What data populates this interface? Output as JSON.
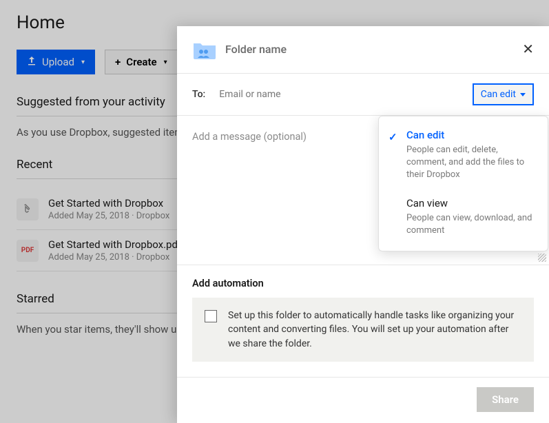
{
  "page": {
    "title": "Home",
    "upload_label": "Upload",
    "create_label": "Create",
    "suggested_heading": "Suggested from your activity",
    "suggested_text": "As you use Dropbox, suggested items will appear here.",
    "recent_heading": "Recent",
    "starred_heading": "Starred",
    "starred_text": "When you star items, they'll show up here.",
    "files": [
      {
        "icon": "paper",
        "name": "Get Started with Dropbox",
        "sub": "Added May 25, 2018 · Dropbox"
      },
      {
        "icon": "pdf",
        "name": "Get Started with Dropbox.pdf",
        "sub": "Added May 25, 2018 · Dropbox"
      }
    ]
  },
  "modal": {
    "folder_name_placeholder": "Folder name",
    "to_label": "To:",
    "email_placeholder": "Email or name",
    "permission_button": "Can edit",
    "message_placeholder": "Add a message (optional)",
    "automation_title": "Add automation",
    "automation_text": "Set up this folder to automatically handle tasks like organizing your content and converting files. You will set up your automation after we share the folder.",
    "share_label": "Share",
    "dropdown": [
      {
        "title": "Can edit",
        "desc": "People can edit, delete, comment, and add the files to their Dropbox",
        "selected": true
      },
      {
        "title": "Can view",
        "desc": "People can view, download, and comment",
        "selected": false
      }
    ]
  }
}
